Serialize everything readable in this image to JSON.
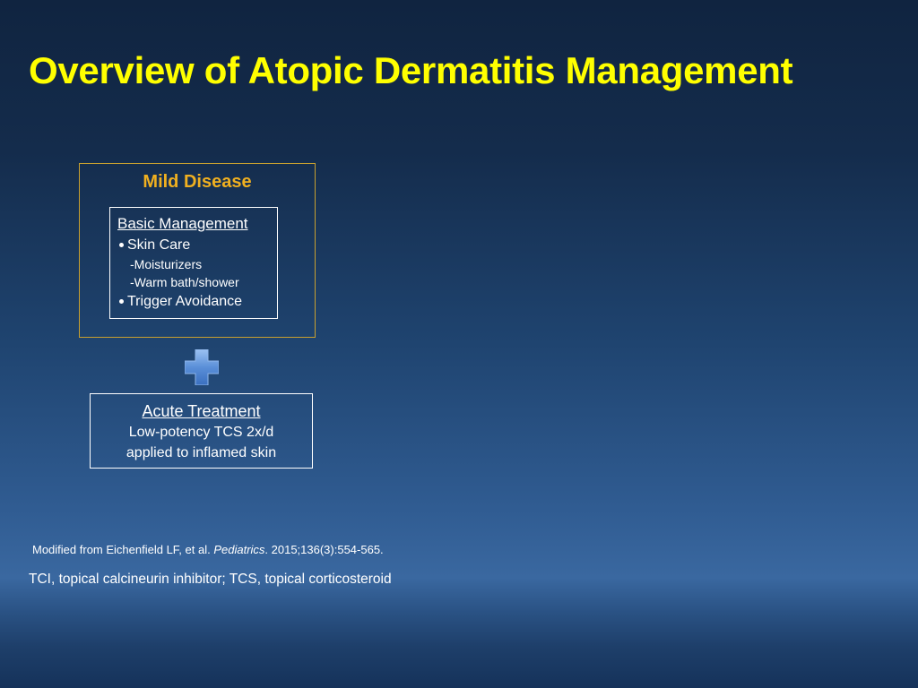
{
  "title": "Overview of Atopic Dermatitis Management",
  "mild_disease": {
    "heading": "Mild Disease",
    "basic_management": {
      "heading": "Basic Management",
      "items": [
        {
          "label": "Skin Care",
          "sub_items": [
            "-Moisturizers",
            "-Warm bath/shower"
          ]
        },
        {
          "label": "Trigger Avoidance",
          "sub_items": []
        }
      ]
    }
  },
  "plus_icon": "plus-icon",
  "acute_treatment": {
    "heading": "Acute Treatment",
    "lines": [
      "Low-potency TCS 2x/d",
      "applied to inflamed skin"
    ]
  },
  "citation": {
    "prefix": "Modified from Eichenfield LF, et al. ",
    "journal": "Pediatrics",
    "suffix": ". 2015;136(3):554-565."
  },
  "footnote": "TCI, topical calcineurin inhibitor; TCS, topical corticosteroid",
  "colors": {
    "title": "#ffff00",
    "mild_heading": "#f0b020",
    "outer_border": "#c8a030",
    "plus_fill": "#5a8fd8"
  }
}
